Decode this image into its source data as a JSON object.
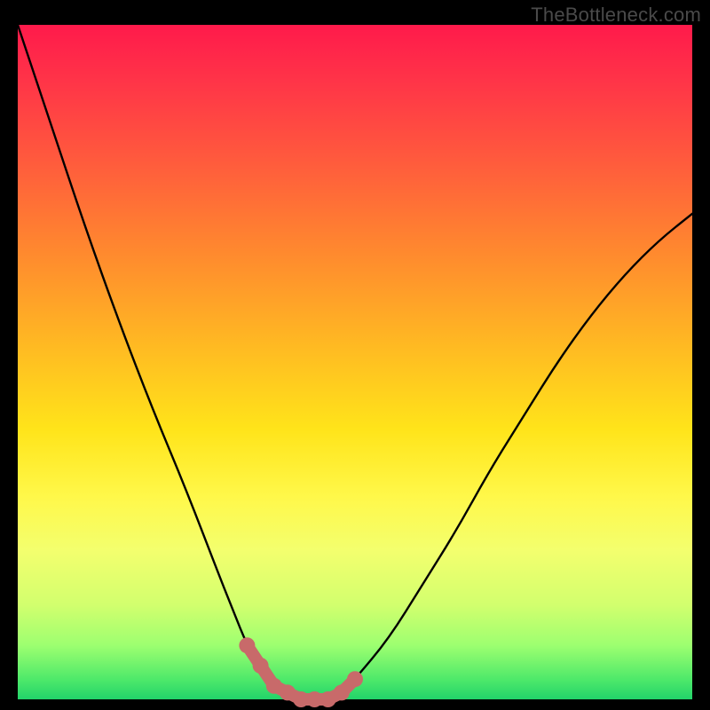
{
  "watermark": "TheBottleneck.com",
  "colors": {
    "background": "#000000",
    "curve": "#000000",
    "marker_fill": "#c86a6a",
    "marker_stroke": "#c86a6a",
    "watermark_text": "#4a4a4a",
    "gradient_top": "#ff1a4b",
    "gradient_bottom": "#22d36a"
  },
  "chart_data": {
    "type": "line",
    "title": "",
    "xlabel": "",
    "ylabel": "",
    "xlim": [
      0,
      100
    ],
    "ylim": [
      0,
      100
    ],
    "grid": false,
    "legend": false,
    "series": [
      {
        "name": "bottleneck-curve",
        "x": [
          0,
          5,
          10,
          15,
          20,
          25,
          30,
          32,
          34,
          36,
          38,
          40,
          42,
          44,
          46,
          48,
          50,
          55,
          60,
          65,
          70,
          75,
          80,
          85,
          90,
          95,
          100
        ],
        "y": [
          100,
          85,
          70,
          56,
          43,
          31,
          18,
          13,
          8,
          5,
          2,
          1,
          0,
          0,
          0,
          1,
          3,
          9,
          17,
          25,
          34,
          42,
          50,
          57,
          63,
          68,
          72
        ]
      }
    ],
    "markers": [
      {
        "x": 34,
        "y": 8
      },
      {
        "x": 36,
        "y": 5
      },
      {
        "x": 38,
        "y": 2
      },
      {
        "x": 40,
        "y": 1
      },
      {
        "x": 42,
        "y": 0
      },
      {
        "x": 44,
        "y": 0
      },
      {
        "x": 46,
        "y": 0
      },
      {
        "x": 48,
        "y": 1
      },
      {
        "x": 50,
        "y": 3
      }
    ],
    "notes": "V-shaped bottleneck curve over a vertical rainbow gradient; x ~ component balance, y ~ bottleneck magnitude. No axis ticks or labels rendered."
  }
}
